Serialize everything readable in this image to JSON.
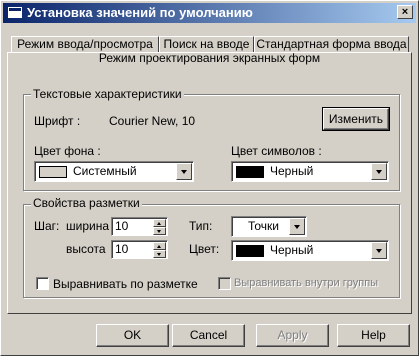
{
  "window": {
    "title": "Установка значений по умолчанию",
    "close_label": "×"
  },
  "tabs": {
    "row_top": [
      "Режим ввода/просмотра",
      "Поиск на вводе",
      "Стандартная форма ввода"
    ],
    "active": "Режим проектирования экранных форм"
  },
  "text_group": {
    "label": "Текстовые характеристики",
    "font_label": "Шрифт :",
    "font_value": "Courier New, 10",
    "change_button": "Изменить",
    "bg_label": "Цвет фона :",
    "bg_value": "Системный",
    "bg_color": "#d4d0c8",
    "fg_label": "Цвет символов :",
    "fg_value": "Черный",
    "fg_color": "#000000"
  },
  "grid_group": {
    "label": "Свойства разметки",
    "step_label": "Шаг:",
    "width_label": "ширина",
    "width_value": "10",
    "height_label": "высота",
    "height_value": "10",
    "type_label": "Тип:",
    "type_value": "Точки",
    "color_label": "Цвет:",
    "color_value": "Черный",
    "color_swatch": "#000000",
    "align_grid_label": "Выравнивать по разметке",
    "align_group_label": "Выравнивать внутри группы"
  },
  "buttons": {
    "ok": "OK",
    "cancel": "Cancel",
    "apply": "Apply",
    "help": "Help"
  }
}
